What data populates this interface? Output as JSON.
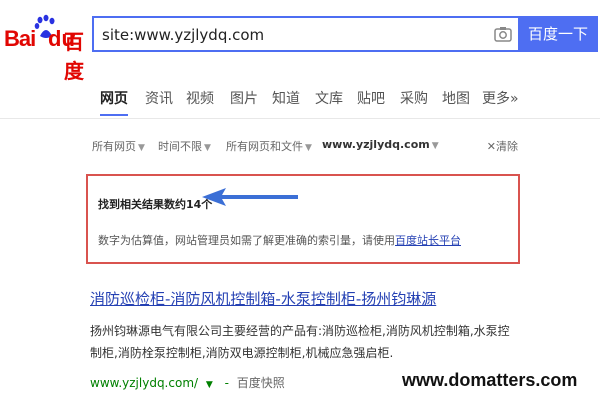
{
  "logo": {
    "text_en_1": "Bai",
    "text_en_2": "du",
    "text_cn": "百度"
  },
  "search": {
    "query": "site:www.yzjlydq.com",
    "button_label": "百度一下"
  },
  "tabs": [
    {
      "label": "网页"
    },
    {
      "label": "资讯"
    },
    {
      "label": "视频"
    },
    {
      "label": "图片"
    },
    {
      "label": "知道"
    },
    {
      "label": "文库"
    },
    {
      "label": "贴吧"
    },
    {
      "label": "采购"
    },
    {
      "label": "地图"
    },
    {
      "label": "更多»"
    }
  ],
  "filters": {
    "all_pages": "所有网页",
    "time": "时间不限",
    "file_types": "所有网页和文件",
    "site": "www.yzjlydq.com",
    "clear": "清除"
  },
  "notice": {
    "count": "找到相关结果数约14个",
    "message_prefix": "数字为估算值，网站管理员如需了解更准确的索引量，请使用",
    "message_link": "百度站长平台"
  },
  "result": {
    "title": "消防巡检柜-消防风机控制箱-水泵控制柜-扬州钧琳源",
    "description": "扬州钧琳源电气有限公司主要经营的产品有:消防巡检柜,消防风机控制箱,水泵控制柜,消防栓泵控制柜,消防双电源控制柜,机械应急强启柜.",
    "url": "www.yzjlydq.com/",
    "snapshot": "百度快照"
  },
  "watermark": "www.domatters.com",
  "colors": {
    "accent": "#4e6ef2",
    "brand_red": "#e10602",
    "link": "#2440b3",
    "url_green": "#008000"
  }
}
